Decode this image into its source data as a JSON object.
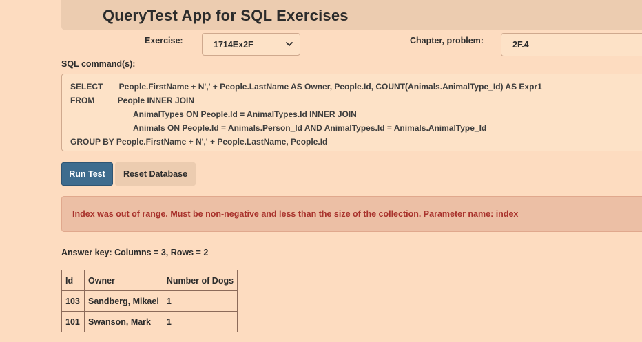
{
  "app": {
    "title": "QueryTest App for SQL Exercises"
  },
  "form": {
    "exercise_label": "Exercise:",
    "exercise_selected": "1714Ex2F",
    "chapter_label": "Chapter, problem:",
    "chapter_value": "2F.4",
    "sql_label": "SQL command(s):"
  },
  "sql": {
    "lines": [
      "SELECT       People.FirstName + N',' + People.LastName AS Owner, People.Id, COUNT(Animals.AnimalType_Id) AS Expr1",
      "FROM          People INNER JOIN",
      "AnimalTypes ON People.Id = AnimalTypes.Id INNER JOIN",
      "Animals ON People.Id = Animals.Person_Id AND AnimalTypes.Id = Animals.AnimalType_Id",
      "GROUP BY People.FirstName + N',' + People.LastName, People.Id"
    ]
  },
  "buttons": {
    "run_label": "Run Test",
    "reset_label": "Reset Database"
  },
  "alert": {
    "message": "Index was out of range. Must be non-negative and less than the size of the collection. Parameter name: index"
  },
  "answer_key": {
    "summary": "Answer key: Columns = 3, Rows = 2",
    "headers": [
      "Id",
      "Owner",
      "Number of Dogs"
    ],
    "rows": [
      [
        "103",
        "Sandberg, Mikael",
        "1"
      ],
      [
        "101",
        "Swanson, Mark",
        "1"
      ]
    ]
  },
  "colors": {
    "page_background": "#fddcc0",
    "header_background": "#ecccb0",
    "run_button": "#3e6c8e",
    "alert_background": "#ecbfa5",
    "alert_text": "#a8322c"
  },
  "icons": {
    "select_chevron": "chevron-down-icon"
  }
}
